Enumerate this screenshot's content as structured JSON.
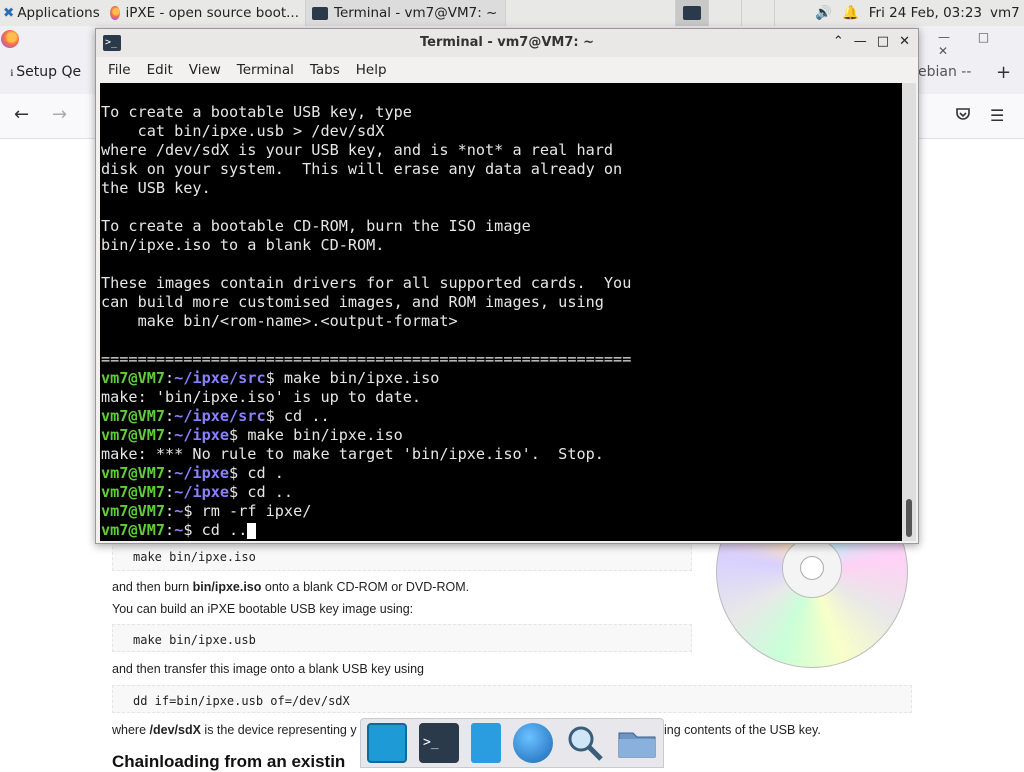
{
  "panel": {
    "applications_label": "Applications",
    "tasks": [
      {
        "title": "iPXE - open source boot..."
      },
      {
        "title": "Terminal - vm7@VM7: ~"
      }
    ],
    "clock": "Fri 24 Feb, 03:23",
    "user": "vm7"
  },
  "firefox": {
    "tab_label": "Setup Qe",
    "tab_right_label": "ebian --",
    "window_controls": "— □ ✕"
  },
  "webpage": {
    "code1": "make bin/ipxe.iso",
    "text1_pre": "and then burn ",
    "text1_bold": "bin/ipxe.iso",
    "text1_post": " onto a blank CD-ROM or DVD-ROM.",
    "text2": "You can build an iPXE bootable USB key image using:",
    "code2": "make bin/ipxe.usb",
    "text3": "and then transfer this image onto a blank USB key using",
    "code3": "dd if=bin/ipxe.usb of=/dev/sdX",
    "text4_pre": "where ",
    "text4_bold": "/dev/sdX",
    "text4_post": " is the device representing y",
    "text4_tail": "ing contents of the USB key.",
    "heading": "Chainloading from an existin"
  },
  "terminal": {
    "title": "Terminal - vm7@VM7: ~",
    "menu": [
      "File",
      "Edit",
      "View",
      "Terminal",
      "Tabs",
      "Help"
    ],
    "output_lines": [
      "To create a bootable USB key, type",
      "    cat bin/ipxe.usb > /dev/sdX",
      "where /dev/sdX is your USB key, and is *not* a real hard",
      "disk on your system.  This will erase any data already on",
      "the USB key.",
      "",
      "To create a bootable CD-ROM, burn the ISO image",
      "bin/ipxe.iso to a blank CD-ROM.",
      "",
      "These images contain drivers for all supported cards.  You",
      "can build more customised images, and ROM images, using",
      "    make bin/<rom-name>.<output-format>",
      "",
      "=========================================================="
    ],
    "session": [
      {
        "user": "vm7@VM7",
        "path": "~/ipxe/src",
        "cmd": " make bin/ipxe.iso"
      },
      {
        "out": "make: 'bin/ipxe.iso' is up to date."
      },
      {
        "user": "vm7@VM7",
        "path": "~/ipxe/src",
        "cmd": " cd .."
      },
      {
        "user": "vm7@VM7",
        "path": "~/ipxe",
        "cmd": " make bin/ipxe.iso"
      },
      {
        "out": "make: *** No rule to make target 'bin/ipxe.iso'.  Stop."
      },
      {
        "user": "vm7@VM7",
        "path": "~/ipxe",
        "cmd": " cd ."
      },
      {
        "user": "vm7@VM7",
        "path": "~/ipxe",
        "cmd": " cd .."
      },
      {
        "user": "vm7@VM7",
        "path": "~",
        "cmd": " rm -rf ipxe/"
      },
      {
        "user": "vm7@VM7",
        "path": "~",
        "cmd": " cd ..",
        "cursor": true
      }
    ],
    "colors": {
      "prompt_user": "#5fcc3a",
      "prompt_path": "#8a80ff",
      "text": "#e6e6e6",
      "background": "#000000"
    }
  },
  "dock": {
    "items": [
      "desktop-icon",
      "terminal-icon",
      "text-editor-icon",
      "web-browser-icon",
      "search-icon",
      "file-manager-icon"
    ]
  }
}
